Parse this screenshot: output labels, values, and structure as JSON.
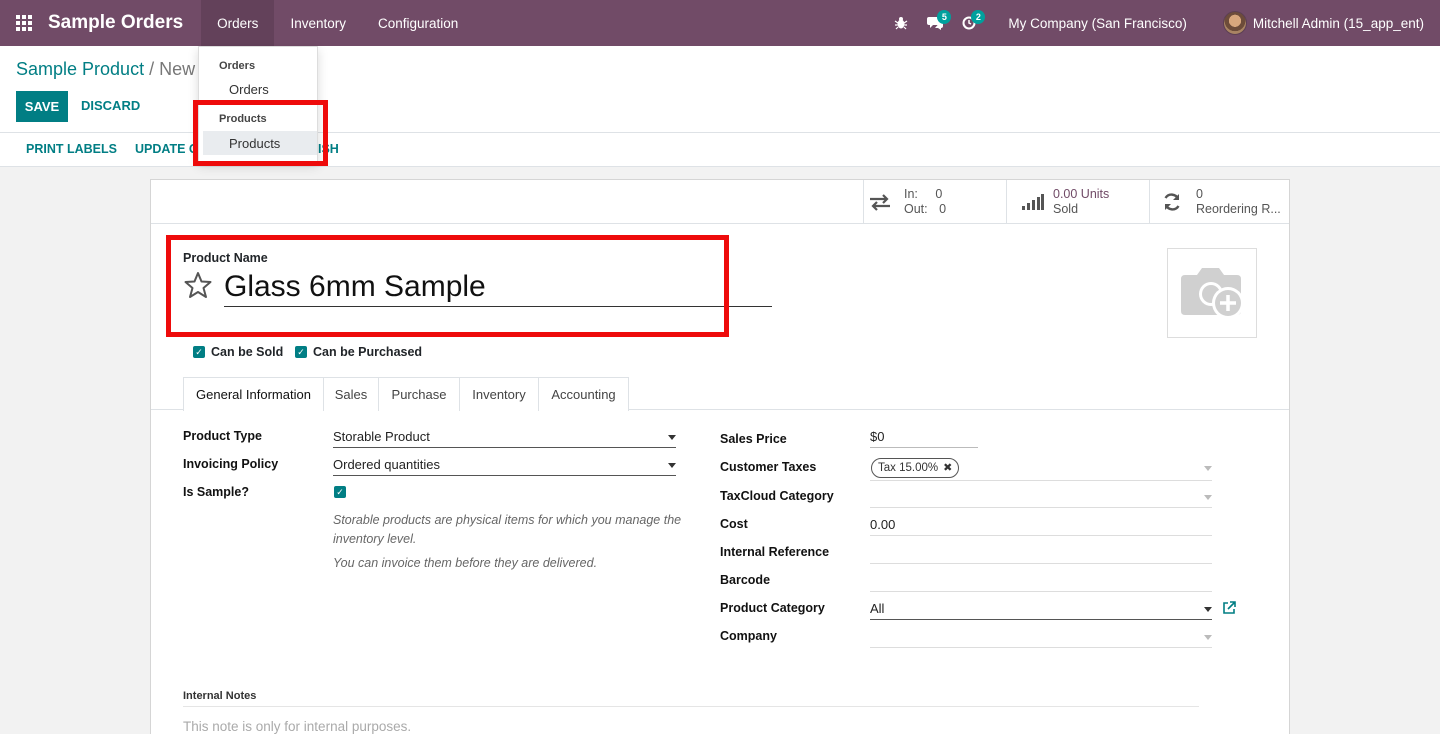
{
  "navbar": {
    "app_name": "Sample Orders",
    "menus": [
      "Orders",
      "Inventory",
      "Configuration"
    ],
    "chat_badge": "5",
    "activity_badge": "2",
    "company": "My Company (San Francisco)",
    "user": "Mitchell Admin (15_app_ent)"
  },
  "dropdown": {
    "section1_header": "Orders",
    "section1_item": "Orders",
    "section2_header": "Products",
    "section2_item": "Products"
  },
  "breadcrumb": {
    "parent": "Sample Product",
    "separator": "/",
    "current": "New"
  },
  "buttons": {
    "save": "SAVE",
    "discard": "DISCARD"
  },
  "statusbar": {
    "print_labels": "PRINT LABELS",
    "update_qty": "UPDATE Q",
    "publish_fragment": "ISH"
  },
  "stats": {
    "in_label": "In:",
    "in_value": "0",
    "out_label": "Out:",
    "out_value": "0",
    "sold_value": "0.00 Units",
    "sold_label": "Sold",
    "reorder_value": "0",
    "reorder_label": "Reordering R..."
  },
  "product": {
    "name_label": "Product Name",
    "name": "Glass 6mm Sample",
    "can_be_sold": "Can be Sold",
    "can_be_purchased": "Can be Purchased"
  },
  "tabs": [
    "General Information",
    "Sales",
    "Purchase",
    "Inventory",
    "Accounting"
  ],
  "general": {
    "product_type_label": "Product Type",
    "product_type": "Storable Product",
    "invoicing_policy_label": "Invoicing Policy",
    "invoicing_policy": "Ordered quantities",
    "is_sample_label": "Is Sample?",
    "help1": "Storable products are physical items for which you manage the inventory level.",
    "help2": "You can invoice them before they are delivered.",
    "sales_price_label": "Sales Price",
    "sales_price": "$0",
    "customer_taxes_label": "Customer Taxes",
    "tax_tag": "Tax 15.00%",
    "taxcloud_label": "TaxCloud Category",
    "cost_label": "Cost",
    "cost": "0.00",
    "internal_ref_label": "Internal Reference",
    "barcode_label": "Barcode",
    "category_label": "Product Category",
    "category": "All",
    "company_label": "Company"
  },
  "notes": {
    "label": "Internal Notes",
    "placeholder": "This note is only for internal purposes."
  },
  "colors": {
    "navbar": "#714b67",
    "accent": "#017e84",
    "highlight_box": "#ee0b0b"
  }
}
